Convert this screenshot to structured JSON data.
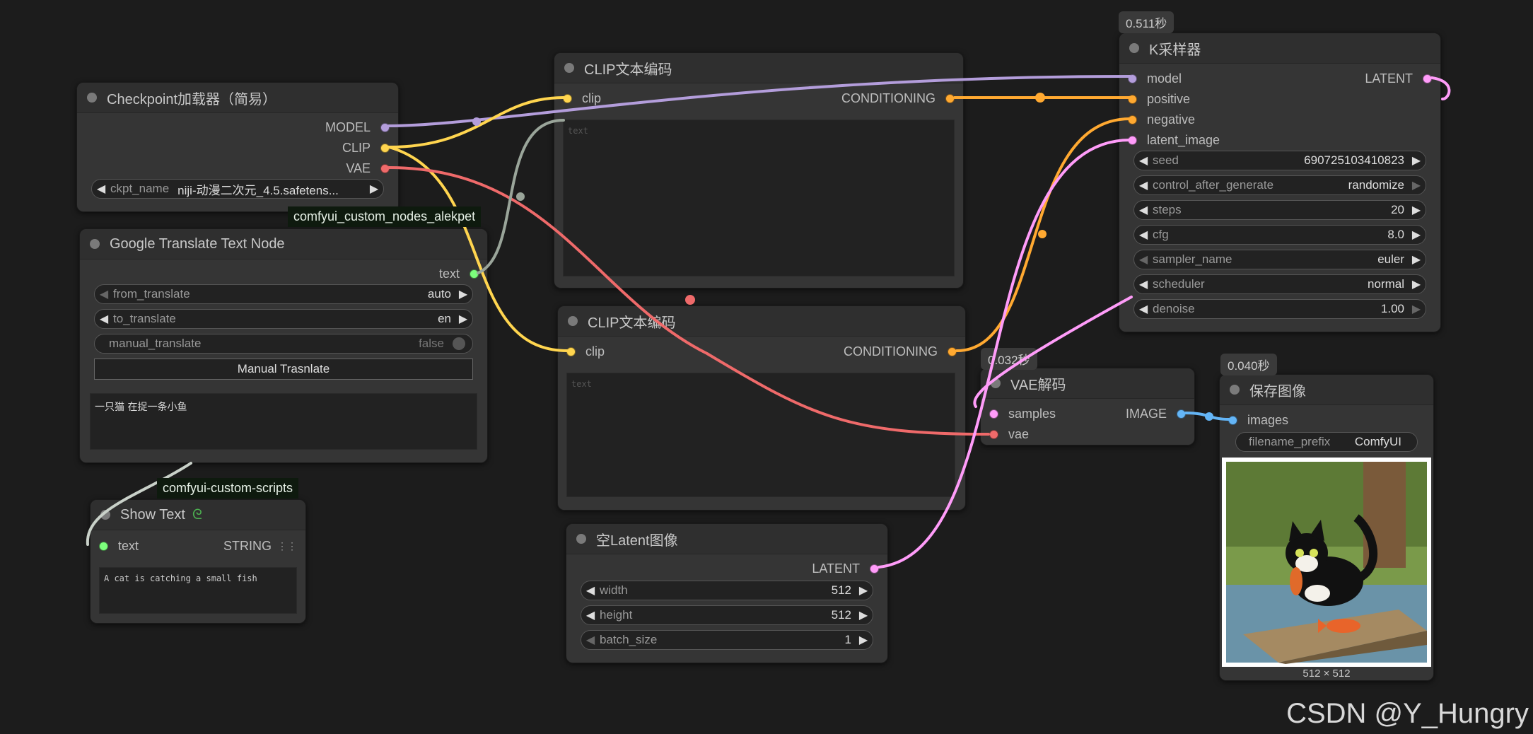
{
  "colors": {
    "model": "#b39ddb",
    "clip": "#ffd54f",
    "vae": "#ef6a6a",
    "conditioning": "#ffa931",
    "latent": "#ff9cf9",
    "image": "#64b5f6",
    "string": "#7cff7c"
  },
  "checkpoint": {
    "title": "Checkpoint加载器（简易）",
    "outputs": [
      "MODEL",
      "CLIP",
      "VAE"
    ],
    "ckpt_name": {
      "name": "ckpt_name",
      "value": "niji-动漫二次元_4.5.safetens..."
    }
  },
  "clip1": {
    "title": "CLIP文本编码",
    "input": "clip",
    "output": "CONDITIONING",
    "placeholder": "text"
  },
  "clip2": {
    "title": "CLIP文本编码",
    "input": "clip",
    "output": "CONDITIONING",
    "placeholder": "text"
  },
  "ksampler": {
    "badge": "0.511秒",
    "title": "K采样器",
    "inputs": [
      "model",
      "positive",
      "negative",
      "latent_image"
    ],
    "output": "LATENT",
    "widgets": [
      {
        "name": "seed",
        "value": "690725103410823"
      },
      {
        "name": "control_after_generate",
        "value": "randomize"
      },
      {
        "name": "steps",
        "value": "20"
      },
      {
        "name": "cfg",
        "value": "8.0"
      },
      {
        "name": "sampler_name",
        "value": "euler"
      },
      {
        "name": "scheduler",
        "value": "normal"
      },
      {
        "name": "denoise",
        "value": "1.00"
      }
    ]
  },
  "google": {
    "tag": "comfyui_custom_nodes_alekpet",
    "title": "Google Translate Text Node",
    "output": "text",
    "from_translate": {
      "name": "from_translate",
      "value": "auto"
    },
    "to_translate": {
      "name": "to_translate",
      "value": "en"
    },
    "manual_translate": {
      "name": "manual_translate",
      "value": "false"
    },
    "button": "Manual Trasnlate",
    "text": "一只猫 在捉一条小鱼"
  },
  "showtext": {
    "tag": "comfyui-custom-scripts",
    "title": "Show Text",
    "input": "text",
    "output": "STRING",
    "text": "A cat is catching a small fish"
  },
  "vaedecode": {
    "badge": "0.032秒",
    "title": "VAE解码",
    "inputs": [
      "samples",
      "vae"
    ],
    "output": "IMAGE"
  },
  "emptylatent": {
    "title": "空Latent图像",
    "output": "LATENT",
    "widgets": [
      {
        "name": "width",
        "value": "512"
      },
      {
        "name": "height",
        "value": "512"
      },
      {
        "name": "batch_size",
        "value": "1"
      }
    ]
  },
  "saveimage": {
    "badge": "0.040秒",
    "title": "保存图像",
    "input": "images",
    "filename_prefix": {
      "name": "filename_prefix",
      "value": "ComfyUI"
    },
    "image_size": "512 × 512"
  },
  "watermark": "CSDN @Y_Hungry"
}
